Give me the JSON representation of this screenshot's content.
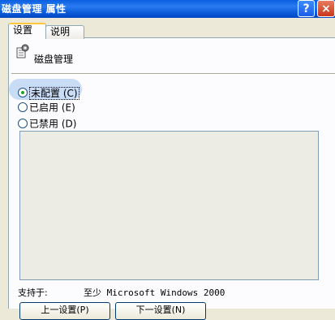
{
  "window": {
    "title": "磁盘管理 属性",
    "help_glyph": "?",
    "close_glyph": "×"
  },
  "tabs": [
    {
      "label": "设置",
      "active": true
    },
    {
      "label": "说明",
      "active": false
    }
  ],
  "policy": {
    "icon": "policy-setting-icon",
    "name": "磁盘管理"
  },
  "options": [
    {
      "label": "未配置 (C)",
      "checked": true
    },
    {
      "label": "已启用 (E)",
      "checked": false
    },
    {
      "label": "已禁用 (D)",
      "checked": false
    }
  ],
  "support": {
    "label": "支持于:",
    "value": "至少 Microsoft Windows 2000"
  },
  "buttons": {
    "prev": "上一设置(P)",
    "next": "下一设置(N)"
  }
}
